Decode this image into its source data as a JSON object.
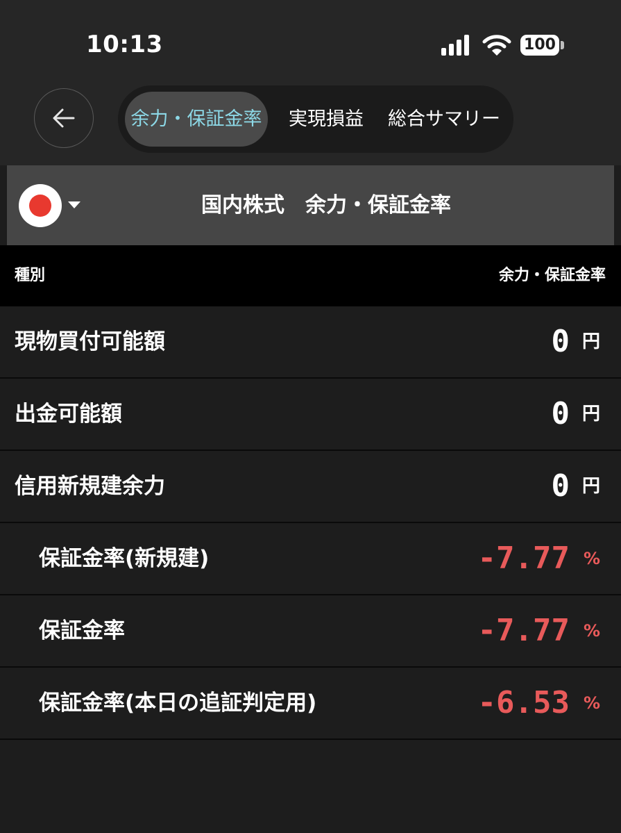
{
  "status_bar": {
    "time": "10:13",
    "battery": "100"
  },
  "nav": {
    "tabs": [
      {
        "label": "余力・保証金率",
        "active": true
      },
      {
        "label": "実現損益",
        "active": false
      },
      {
        "label": "総合サマリー",
        "active": false
      }
    ]
  },
  "market": {
    "title": "国内株式　余力・保証金率",
    "flag": "japan-flag"
  },
  "table": {
    "headers": {
      "type": "種別",
      "value": "余力・保証金率"
    },
    "rows": [
      {
        "label": "現物買付可能額",
        "value": "0",
        "unit": "円"
      },
      {
        "label": "出金可能額",
        "value": "0",
        "unit": "円"
      },
      {
        "label": "信用新規建余力",
        "value": "0",
        "unit": "円"
      },
      {
        "label": "保証金率(新規建)",
        "value": "-7.77",
        "unit": "%"
      },
      {
        "label": "保証金率",
        "value": "-7.77",
        "unit": "%"
      },
      {
        "label": "保証金率(本日の追証判定用)",
        "value": "-6.53",
        "unit": "%"
      }
    ]
  },
  "colors": {
    "background": "#1d1d1d",
    "active_tab_text": "#8cd8e6",
    "negative": "#e85a5a",
    "flag_red": "#e8392f"
  }
}
